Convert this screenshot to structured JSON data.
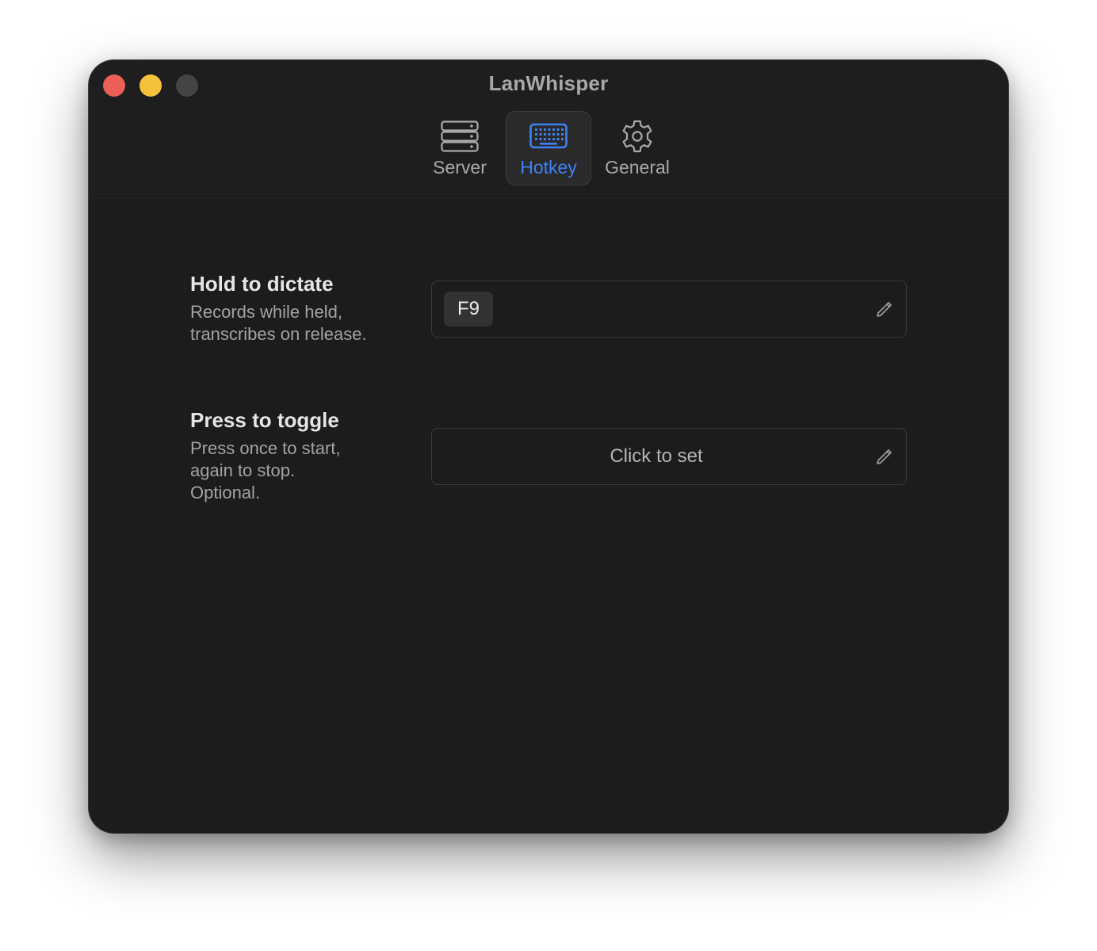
{
  "window": {
    "title": "LanWhisper"
  },
  "toolbar": {
    "tabs": [
      {
        "label": "Server",
        "icon": "server-icon",
        "active": false
      },
      {
        "label": "Hotkey",
        "icon": "keyboard-icon",
        "active": true
      },
      {
        "label": "General",
        "icon": "gear-icon",
        "active": false
      }
    ]
  },
  "hotkeys": {
    "hold": {
      "title": "Hold to dictate",
      "desc_line1": "Records while held,",
      "desc_line2": "transcribes on release.",
      "value": "F9"
    },
    "toggle": {
      "title": "Press to toggle",
      "desc_line1": "Press once to start,",
      "desc_line2": "again to stop.",
      "desc_line3": "Optional.",
      "placeholder": "Click to set"
    }
  },
  "colors": {
    "accent": "#3c82f6",
    "close": "#ec5f57",
    "minimize": "#f5c33b",
    "zoom_disabled": "#444444",
    "background": "#1c1c1c"
  }
}
